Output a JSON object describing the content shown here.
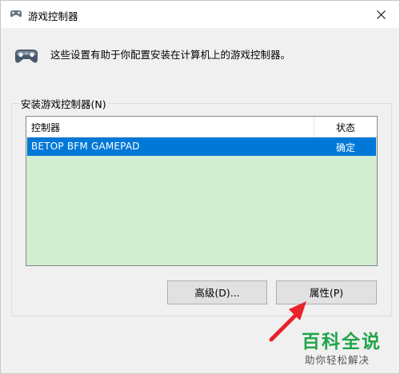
{
  "window": {
    "title": "游戏控制器",
    "close_glyph": "✕"
  },
  "header": {
    "description": "这些设置有助于你配置安装在计算机上的游戏控制器。"
  },
  "group": {
    "label": "安装游戏控制器(N)"
  },
  "list": {
    "columns": [
      "控制器",
      "状态"
    ],
    "rows": [
      {
        "name": "BETOP BFM GAMEPAD",
        "status": "确定",
        "selected": true
      }
    ],
    "background_color": "#d1eed1",
    "selection_color": "#0078d7"
  },
  "buttons": {
    "advanced_label": "高级(D)...",
    "properties_label": "属性(P)"
  },
  "watermark": {
    "title": "百科全说",
    "subtitle": "助你轻松解决",
    "color": "#22a44a"
  },
  "annotation": {
    "arrow_color": "#e8232a"
  },
  "icons": {
    "title": "gamepad-icon",
    "header": "gamepad-icon",
    "close": "close-icon"
  }
}
